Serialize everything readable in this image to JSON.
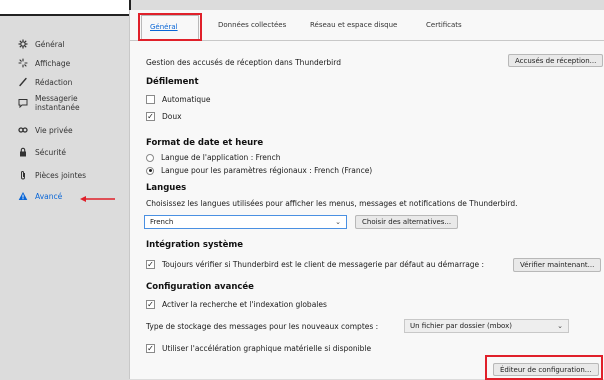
{
  "sidebar": {
    "items": [
      {
        "label": "Général",
        "icon": "gear-icon"
      },
      {
        "label": "Affichage",
        "icon": "sparkle-icon"
      },
      {
        "label": "Rédaction",
        "icon": "pen-icon"
      },
      {
        "label_line1": "Messagerie",
        "label_line2": "instantanée",
        "icon": "chat-icon"
      },
      {
        "label": "Vie privée",
        "icon": "mask-icon"
      },
      {
        "label": "Sécurité",
        "icon": "lock-icon"
      },
      {
        "label": "Pièces jointes",
        "icon": "paperclip-icon"
      },
      {
        "label": "Avancé",
        "icon": "warning-icon"
      }
    ]
  },
  "tabs": [
    {
      "label": "Général"
    },
    {
      "label": "Données collectées"
    },
    {
      "label": "Réseau et espace disque"
    },
    {
      "label": "Certificats"
    }
  ],
  "receipts": {
    "text": "Gestion des accusés de réception dans Thunderbird",
    "button": "Accusés de réception..."
  },
  "scrolling": {
    "title": "Défilement",
    "auto": "Automatique",
    "smooth": "Doux"
  },
  "date_format": {
    "title": "Format de date et heure",
    "option_app": "Langue de l'application : French",
    "option_regional": "Langue pour les paramètres régionaux : French (France)"
  },
  "languages": {
    "title": "Langues",
    "description": "Choisissez les langues utilisées pour afficher les menus, messages et notifications de Thunderbird.",
    "selected": "French",
    "alternatives_button": "Choisir des alternatives..."
  },
  "system": {
    "title": "Intégration système",
    "check_default": "Toujours vérifier si Thunderbird est le client de messagerie par défaut au démarrage :",
    "check_now_button": "Vérifier maintenant..."
  },
  "advanced": {
    "title": "Configuration avancée",
    "global_search": "Activer la recherche et l'indexation globales",
    "storage_label": "Type de stockage des messages pour les nouveaux comptes :",
    "storage_value": "Un fichier par dossier (mbox)",
    "hw_accel": "Utiliser l'accélération graphique matérielle si disponible",
    "config_editor_button": "Éditeur de configuration..."
  },
  "colors": {
    "accent": "#0a66d6",
    "highlight": "#e0202a"
  }
}
